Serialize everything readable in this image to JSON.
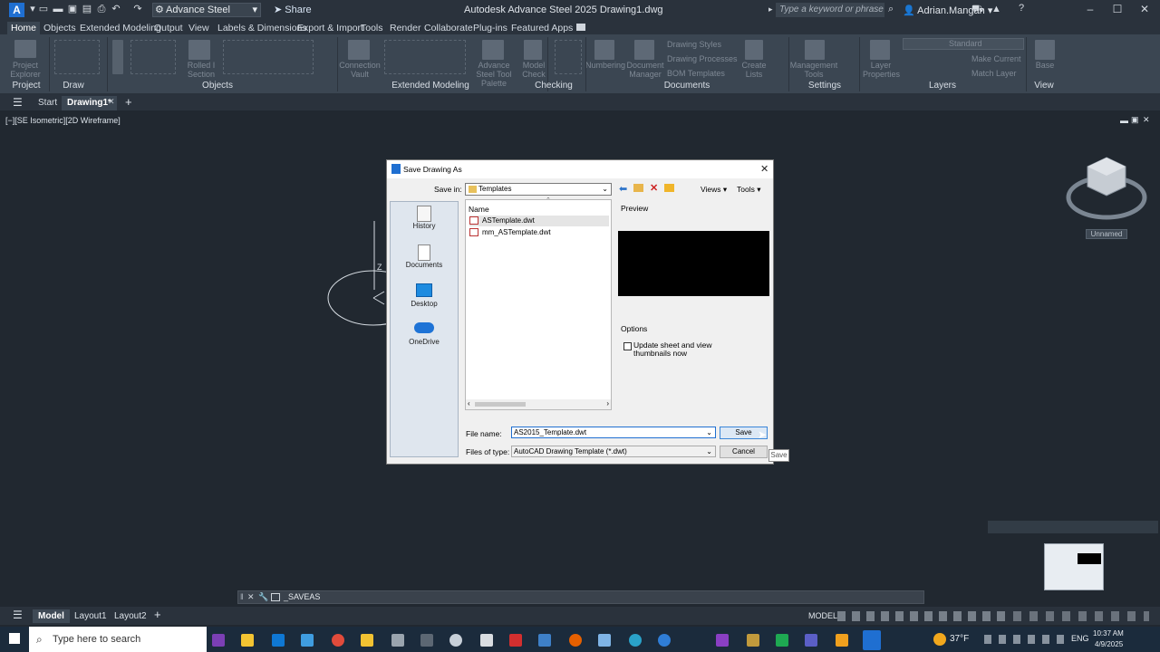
{
  "app": {
    "logo": "A",
    "title": "Autodesk Advance Steel 2025   Drawing1.dwg",
    "workspace": "Advance Steel",
    "share": "Share",
    "search_placeholder": "Type a keyword or phrase",
    "user": "Adrian.Mangan"
  },
  "ribbon": {
    "tabs": [
      "Home",
      "Objects",
      "Extended Modeling",
      "Output",
      "View",
      "Labels & Dimensions",
      "Export & Import",
      "Tools",
      "Render",
      "Collaborate",
      "Plug-ins",
      "Featured Apps"
    ],
    "active_tab": "Home",
    "groups": [
      "Project",
      "Draw",
      "Objects",
      "Extended Modeling",
      "Checking",
      "Documents",
      "Settings",
      "Layers",
      "View"
    ],
    "labels": {
      "project_explorer": "Project Explorer",
      "rolled_section": "Rolled I Section",
      "connection_vault": "Connection Vault",
      "tool_palette": "Advance Steel Tool Palette",
      "model_check": "Model Check",
      "numbering": "Numbering",
      "document_manager": "Document Manager",
      "drawing_styles": "Drawing Styles",
      "drawing_processes": "Drawing Processes",
      "bom_templates": "BOM Templates",
      "create_lists": "Create Lists",
      "management_tools": "Management Tools",
      "layer_properties": "Layer Properties",
      "layer_state": "Standard",
      "make_current": "Make Current",
      "match_layer": "Match Layer",
      "base": "Base"
    }
  },
  "doc_tabs": {
    "start": "Start",
    "drawing": "Drawing1*"
  },
  "viewport": {
    "label": "[−][SE Isometric][2D Wireframe]",
    "viewcube_unnamed": "Unnamed",
    "axis_z": "Z"
  },
  "dialog": {
    "title": "Save Drawing As",
    "save_in_label": "Save in:",
    "save_in_value": "Templates",
    "views_label": "Views",
    "tools_label": "Tools",
    "places": [
      "History",
      "Documents",
      "Desktop",
      "OneDrive"
    ],
    "column_name": "Name",
    "files": [
      "ASTemplate.dwt",
      "mm_ASTemplate.dwt"
    ],
    "preview_label": "Preview",
    "options_label": "Options",
    "update_thumbnails": "Update sheet and view thumbnails now",
    "file_name_label": "File name:",
    "file_name_value": "AS2015_Template.dwt",
    "file_type_label": "Files of type:",
    "file_type_value": "AutoCAD Drawing Template (*.dwt)",
    "save_button": "Save",
    "cancel_button": "Cancel",
    "tooltip": "Save"
  },
  "command_line": {
    "text": "_SAVEAS"
  },
  "layout_tabs": [
    "Model",
    "Layout1",
    "Layout2"
  ],
  "status": {
    "model": "MODEL"
  },
  "taskbar": {
    "search_placeholder": "Type here to search",
    "weather": "37°F",
    "language": "ENG",
    "time": "10:37 AM",
    "date": "4/9/2025"
  },
  "colors": {
    "accent": "#1f6fd1",
    "ribbon_bg": "#3b4652",
    "titlebar_bg": "#2a323c",
    "viewport_bg": "#212830",
    "taskbar_bg": "#1b2b3c"
  }
}
